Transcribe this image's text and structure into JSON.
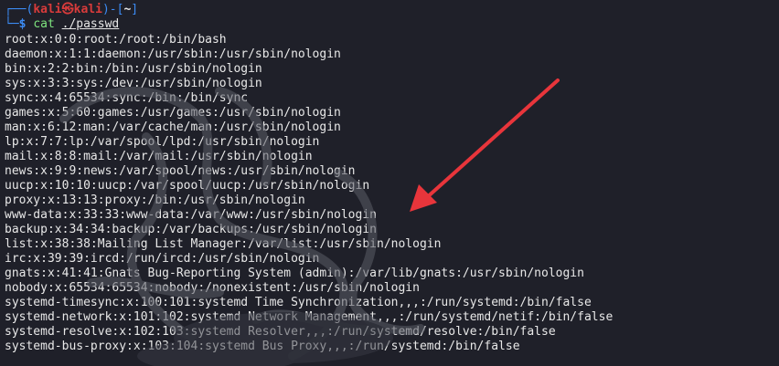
{
  "prompt": {
    "corner_top": "┌──(",
    "user": "kali",
    "at_symbol": "㉿",
    "host": "kali",
    "sep": ")-[",
    "dir": "~",
    "close": "]",
    "corner_bottom": "└─",
    "dollar": "$"
  },
  "command": {
    "name": "cat",
    "arg": "./passwd"
  },
  "output_lines": [
    "root:x:0:0:root:/root:/bin/bash",
    "daemon:x:1:1:daemon:/usr/sbin:/usr/sbin/nologin",
    "bin:x:2:2:bin:/bin:/usr/sbin/nologin",
    "sys:x:3:3:sys:/dev:/usr/sbin/nologin",
    "sync:x:4:65534:sync:/bin:/bin/sync",
    "games:x:5:60:games:/usr/games:/usr/sbin/nologin",
    "man:x:6:12:man:/var/cache/man:/usr/sbin/nologin",
    "lp:x:7:7:lp:/var/spool/lpd:/usr/sbin/nologin",
    "mail:x:8:8:mail:/var/mail:/usr/sbin/nologin",
    "news:x:9:9:news:/var/spool/news:/usr/sbin/nologin",
    "uucp:x:10:10:uucp:/var/spool/uucp:/usr/sbin/nologin",
    "proxy:x:13:13:proxy:/bin:/usr/sbin/nologin",
    "www-data:x:33:33:www-data:/var/www:/usr/sbin/nologin",
    "backup:x:34:34:backup:/var/backups:/usr/sbin/nologin",
    "list:x:38:38:Mailing List Manager:/var/list:/usr/sbin/nologin",
    "irc:x:39:39:ircd:/run/ircd:/usr/sbin/nologin",
    "gnats:x:41:41:Gnats Bug-Reporting System (admin):/var/lib/gnats:/usr/sbin/nologin",
    "nobody:x:65534:65534:nobody:/nonexistent:/usr/sbin/nologin",
    "systemd-timesync:x:100:101:systemd Time Synchronization,,,:/run/systemd:/bin/false",
    "systemd-network:x:101:102:systemd Network Management,,,:/run/systemd/netif:/bin/false",
    "systemd-resolve:x:102:103:systemd Resolver,,,:/run/systemd/resolve:/bin/false",
    "systemd-bus-proxy:x:103:104:systemd Bus Proxy,,,:/run/systemd:/bin/false"
  ],
  "colors": {
    "background": "#1f2029",
    "prompt_blue": "#3c8cf5",
    "prompt_red": "#d93b3b",
    "command_green": "#7ee37e",
    "arrow_red": "#e8353b"
  }
}
